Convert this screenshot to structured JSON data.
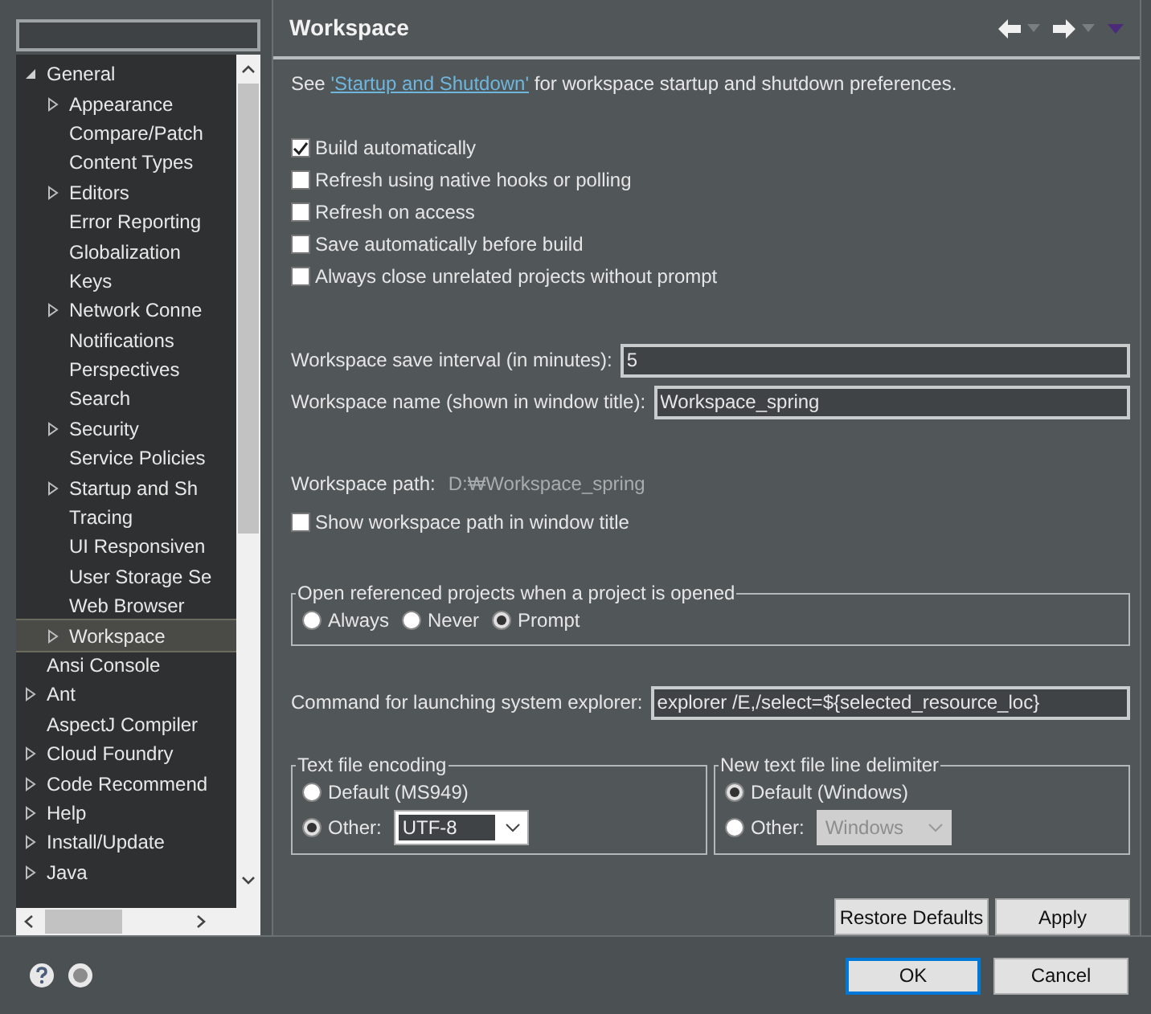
{
  "tree": [
    {
      "label": "General",
      "expanded": true,
      "selected": false,
      "children": [
        {
          "label": "Appearance",
          "expanded": false,
          "selected": false
        },
        {
          "label": "Compare/Patch",
          "selected": false
        },
        {
          "label": "Content Types",
          "selected": false
        },
        {
          "label": "Editors",
          "expanded": false,
          "selected": false
        },
        {
          "label": "Error Reporting",
          "selected": false
        },
        {
          "label": "Globalization",
          "selected": false
        },
        {
          "label": "Keys",
          "selected": false
        },
        {
          "label": "Network Conne",
          "expanded": false,
          "selected": false
        },
        {
          "label": "Notifications",
          "selected": false
        },
        {
          "label": "Perspectives",
          "selected": false
        },
        {
          "label": "Search",
          "selected": false
        },
        {
          "label": "Security",
          "expanded": false,
          "selected": false
        },
        {
          "label": "Service Policies",
          "selected": false
        },
        {
          "label": "Startup and Sh",
          "expanded": false,
          "selected": false
        },
        {
          "label": "Tracing",
          "selected": false
        },
        {
          "label": "UI Responsiven",
          "selected": false
        },
        {
          "label": "User Storage Se",
          "selected": false
        },
        {
          "label": "Web Browser",
          "selected": false
        },
        {
          "label": "Workspace",
          "expanded": false,
          "selected": true
        }
      ]
    },
    {
      "label": "Ansi Console",
      "selected": false
    },
    {
      "label": "Ant",
      "expanded": false,
      "selected": false
    },
    {
      "label": "AspectJ Compiler",
      "selected": false
    },
    {
      "label": "Cloud Foundry",
      "expanded": false,
      "selected": false
    },
    {
      "label": "Code Recommend",
      "expanded": false,
      "selected": false
    },
    {
      "label": "Help",
      "expanded": false,
      "selected": false
    },
    {
      "label": "Install/Update",
      "expanded": false,
      "selected": false
    },
    {
      "label": "Java",
      "expanded": false,
      "selected": false
    }
  ],
  "page": {
    "title": "Workspace",
    "intro": {
      "before": "See ",
      "link": "'Startup and Shutdown'",
      "after": " for workspace startup and shutdown preferences."
    },
    "checkboxes": [
      {
        "label": "Build automatically",
        "checked": true
      },
      {
        "label": "Refresh using native hooks or polling",
        "checked": false
      },
      {
        "label": "Refresh on access",
        "checked": false
      },
      {
        "label": "Save automatically before build",
        "checked": false
      },
      {
        "label": "Always close unrelated projects without prompt",
        "checked": false
      }
    ],
    "save_interval": {
      "label": "Workspace save interval (in minutes):",
      "value": "5"
    },
    "workspace_name": {
      "label": "Workspace name (shown in window title):",
      "value": "Workspace_spring"
    },
    "workspace_path": {
      "label": "Workspace path:",
      "value": "D:₩Workspace_spring"
    },
    "show_path": {
      "label": "Show workspace path in window title",
      "checked": false
    },
    "open_referenced": {
      "title": "Open referenced projects when a project is opened",
      "options": [
        {
          "label": "Always",
          "selected": false
        },
        {
          "label": "Never",
          "selected": false
        },
        {
          "label": "Prompt",
          "selected": true
        }
      ]
    },
    "explorer_command": {
      "label": "Command for launching system explorer:",
      "value": "explorer /E,/select=${selected_resource_loc}"
    },
    "encoding": {
      "title": "Text file encoding",
      "options": [
        {
          "label": "Default (MS949)",
          "selected": false
        },
        {
          "label": "Other:",
          "selected": true
        }
      ],
      "combo": {
        "value": "UTF-8",
        "disabled": false
      }
    },
    "delimiter": {
      "title": "New text file line delimiter",
      "options": [
        {
          "label": "Default (Windows)",
          "selected": true
        },
        {
          "label": "Other:",
          "selected": false
        }
      ],
      "combo": {
        "value": "Windows",
        "disabled": true
      }
    },
    "buttons": [
      "Restore Defaults",
      "Apply"
    ]
  },
  "footer": {
    "buttons": [
      {
        "label": "OK",
        "default": true
      },
      {
        "label": "Cancel",
        "default": false
      }
    ]
  }
}
